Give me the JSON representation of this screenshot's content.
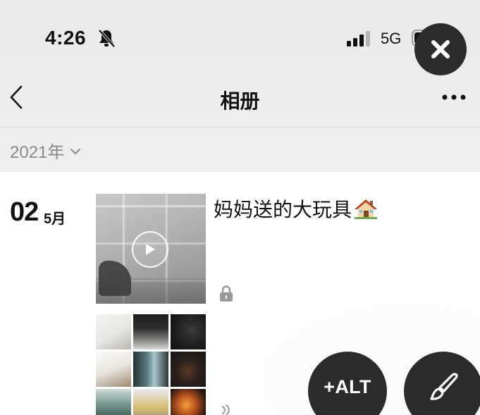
{
  "status_bar": {
    "time": "4:26",
    "network": "5G",
    "bell_icon": "bell-slash-icon",
    "signal_icon": "cellular-signal-icon",
    "battery_icon": "battery-icon"
  },
  "nav": {
    "title": "相册",
    "back_icon": "chevron-left-icon",
    "more_icon": "more-dots-icon"
  },
  "filter": {
    "year_label": "2021年",
    "icon": "chevron-down-icon"
  },
  "entry": {
    "day": "02",
    "month": "5月",
    "text": "妈妈送的大玩具",
    "emoji_icon": "house-icon",
    "video_icon": "play-icon",
    "privacy_icon": "lock-icon"
  },
  "overlay": {
    "close_icon": "close-icon",
    "alt_label": "+ALT",
    "edit_icon": "paintbrush-icon"
  },
  "colors": {
    "header_bg": "#ededed",
    "fab_bg": "#2b2b2b",
    "muted_text": "#8a8a8a"
  }
}
